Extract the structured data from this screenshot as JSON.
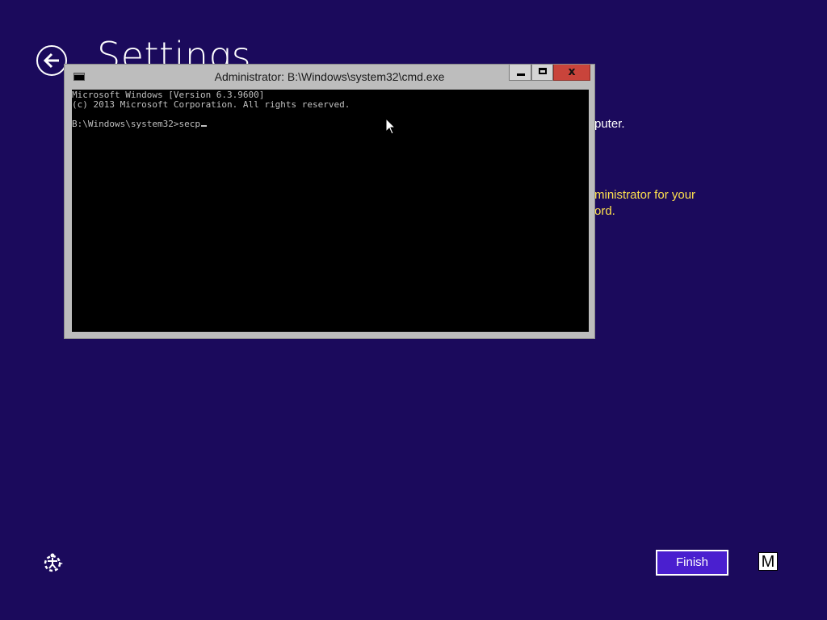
{
  "background": {
    "page_title": "Settings",
    "text_lines": [
      "puter.",
      "ministrator for your",
      "ord."
    ]
  },
  "cmd": {
    "title": "Administrator: B:\\Windows\\system32\\cmd.exe",
    "close_glyph": "x",
    "lines": [
      "Microsoft Windows [Version 6.3.9600]",
      "(c) 2013 Microsoft Corporation. All rights reserved.",
      "B:\\Windows\\system32>secp"
    ]
  },
  "footer": {
    "finish_label": "Finish",
    "ime_label": "M"
  },
  "colors": {
    "background": "#1b0a5c",
    "accent_text": "#ffe14d",
    "finish_button": "#4a1fcf",
    "close_button": "#c9443b"
  },
  "icons": {
    "back": "back-arrow-icon",
    "cmd": "cmd-icon",
    "ease_of_access": "ease-of-access-icon",
    "cursor": "mouse-cursor-icon"
  }
}
